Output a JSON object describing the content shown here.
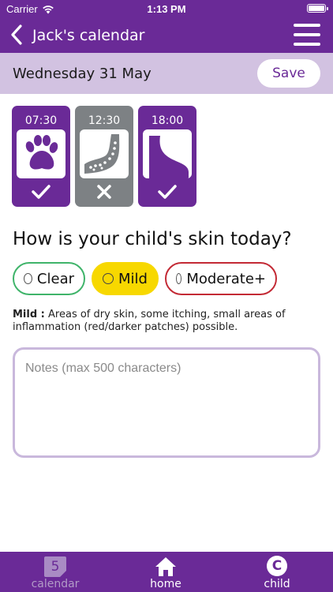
{
  "status_bar": {
    "carrier": "Carrier",
    "time": "1:13 PM"
  },
  "header": {
    "title": "Jack's calendar",
    "back_icon": "chevron-left-icon",
    "menu_icon": "hamburger-menu-icon"
  },
  "date_bar": {
    "date": "Wednesday 31 May",
    "save_label": "Save"
  },
  "time_slots": [
    {
      "time": "07:30",
      "icon": "paw-icon",
      "status": "done",
      "color": "#6a2a97"
    },
    {
      "time": "12:30",
      "icon": "arm-icon",
      "status": "missed",
      "color": "#7d8184"
    },
    {
      "time": "18:00",
      "icon": "foot-icon",
      "status": "done",
      "color": "#6a2a97"
    }
  ],
  "question": "How is your child's skin today?",
  "options": [
    {
      "label": "Clear",
      "color": "#3fb46a",
      "selected": false
    },
    {
      "label": "Mild",
      "color": "#f7d800",
      "selected": true
    },
    {
      "label": "Moderate+",
      "color": "#c32a35",
      "selected": false
    }
  ],
  "description": {
    "term": "Mild",
    "separator": " :",
    "text": " Areas of dry skin, some itching, small areas of inflammation (red/darker patches) possible."
  },
  "notes": {
    "placeholder": "Notes (max 500 characters)"
  },
  "tabbar": {
    "calendar": {
      "label": "calendar",
      "badge": "5"
    },
    "home": {
      "label": "home"
    },
    "child": {
      "label": "child",
      "initial": "C"
    }
  },
  "colors": {
    "primary": "#6a2a97",
    "date_bar": "#d2c2e1",
    "notes_border": "#c9b8dc"
  }
}
